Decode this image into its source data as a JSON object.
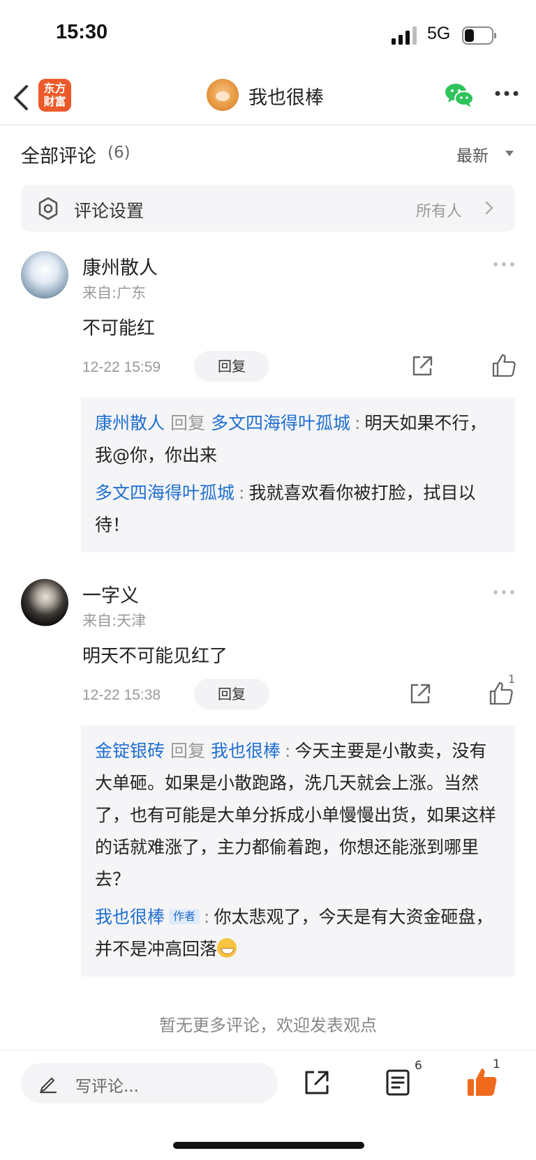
{
  "status_bar": {
    "time": "15:30",
    "network": "5G",
    "battery_fraction": 0.35
  },
  "nav": {
    "app_logo_line1": "东方",
    "app_logo_line2": "财富",
    "title": "我也很棒",
    "icons": [
      "back-icon",
      "wechat-icon",
      "more-icon"
    ]
  },
  "comments_header": {
    "title": "全部评论",
    "count": "(6)",
    "sort": "最新"
  },
  "settings": {
    "label": "评论设置",
    "value": "所有人"
  },
  "comments": [
    {
      "name": "康州散人",
      "location": "来自:广东",
      "text": "不可能红",
      "time": "12-22 15:59",
      "reply_button": "回复",
      "likes": "",
      "replies": [
        {
          "from": "康州散人",
          "reply_word": "回复",
          "to": "多文四海得叶孤城",
          "text": "明天如果不行，我@你，你出来"
        },
        {
          "from": "多文四海得叶孤城",
          "text": "我就喜欢看你被打脸，拭目以待！"
        }
      ]
    },
    {
      "name": "一字义",
      "location": "来自:天津",
      "text": "明天不可能见红了",
      "time": "12-22 15:38",
      "reply_button": "回复",
      "likes": "1",
      "replies": [
        {
          "from": "金锭银砖",
          "reply_word": "回复",
          "to": "我也很棒",
          "text": "今天主要是小散卖，没有大单砸。如果是小散跑路，洗几天就会上涨。当然了，也有可能是大单分拆成小单慢慢出货，如果这样的话就难涨了，主力都偷着跑，你想还能涨到哪里去？"
        },
        {
          "from": "我也很棒",
          "author_tag": "作者",
          "text": "你太悲观了，今天是有大资金砸盘，并不是冲高回落"
        }
      ]
    }
  ],
  "footer_note": "暂无更多评论，欢迎发表观点",
  "bottom_bar": {
    "input_placeholder": "写评论...",
    "comment_count": "6",
    "like_count": "1"
  },
  "colors": {
    "brand_orange": "#ec5a2a",
    "link_blue": "#1f6fd1",
    "like_orange": "#f06a1d",
    "wechat_green": "#2fc35b"
  }
}
